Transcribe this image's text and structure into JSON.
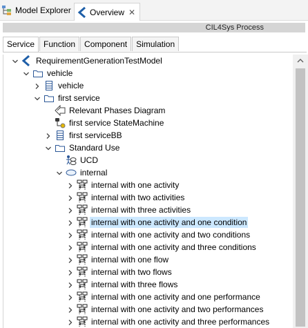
{
  "views": [
    {
      "label": "Model Explorer",
      "icon": "model-explorer-icon",
      "active": false
    },
    {
      "label": "Overview",
      "icon": "overview-icon",
      "active": true
    }
  ],
  "title_bar": "CIL4Sys Process",
  "tabs": [
    {
      "label": "Service",
      "selected": true
    },
    {
      "label": "Function",
      "selected": false
    },
    {
      "label": "Component",
      "selected": false
    },
    {
      "label": "Simulation",
      "selected": false
    }
  ],
  "tree": [
    {
      "label": "RequirementGenerationTestModel",
      "level": 0,
      "expander": "expanded",
      "icon": "model-icon"
    },
    {
      "label": "vehicle",
      "level": 1,
      "expander": "expanded",
      "icon": "folder-icon"
    },
    {
      "label": "vehicle",
      "level": 2,
      "expander": "collapsed",
      "icon": "block-icon"
    },
    {
      "label": "first service",
      "level": 2,
      "expander": "expanded",
      "icon": "folder-icon"
    },
    {
      "label": "Relevant Phases Diagram",
      "level": 3,
      "expander": "none",
      "icon": "phases-diagram-icon"
    },
    {
      "label": "first service StateMachine",
      "level": 3,
      "expander": "none",
      "icon": "state-machine-icon"
    },
    {
      "label": "first serviceBB",
      "level": 3,
      "expander": "collapsed",
      "icon": "block-icon"
    },
    {
      "label": "Standard Use",
      "level": 3,
      "expander": "expanded",
      "icon": "folder-icon"
    },
    {
      "label": "UCD",
      "level": 4,
      "expander": "none",
      "icon": "use-case-diagram-icon"
    },
    {
      "label": "internal",
      "level": 4,
      "expander": "expanded",
      "icon": "use-case-icon"
    },
    {
      "label": "internal with one activity",
      "level": 5,
      "expander": "collapsed",
      "icon": "interaction-icon"
    },
    {
      "label": "internal with two activities",
      "level": 5,
      "expander": "collapsed",
      "icon": "interaction-icon"
    },
    {
      "label": "internal with three activities",
      "level": 5,
      "expander": "collapsed",
      "icon": "interaction-icon"
    },
    {
      "label": "internal with one activity and one condition",
      "level": 5,
      "expander": "collapsed",
      "icon": "interaction-icon",
      "selected": true
    },
    {
      "label": "internal with one activity and two conditions",
      "level": 5,
      "expander": "collapsed",
      "icon": "interaction-icon"
    },
    {
      "label": "internal with one activity and three conditions",
      "level": 5,
      "expander": "collapsed",
      "icon": "interaction-icon"
    },
    {
      "label": "internal with one flow",
      "level": 5,
      "expander": "collapsed",
      "icon": "interaction-icon"
    },
    {
      "label": "internal with two flows",
      "level": 5,
      "expander": "collapsed",
      "icon": "interaction-icon"
    },
    {
      "label": "internal with three flows",
      "level": 5,
      "expander": "collapsed",
      "icon": "interaction-icon"
    },
    {
      "label": "internal with one activity and one performance",
      "level": 5,
      "expander": "collapsed",
      "icon": "interaction-icon"
    },
    {
      "label": "internal with one activity and two performances",
      "level": 5,
      "expander": "collapsed",
      "icon": "interaction-icon"
    },
    {
      "label": "internal with one activity and three performances",
      "level": 5,
      "expander": "collapsed",
      "icon": "interaction-icon"
    }
  ],
  "colors": {
    "selection": "#cce8ff",
    "accent": "#1f5fa8",
    "title_bar": "#d5d5d5"
  }
}
